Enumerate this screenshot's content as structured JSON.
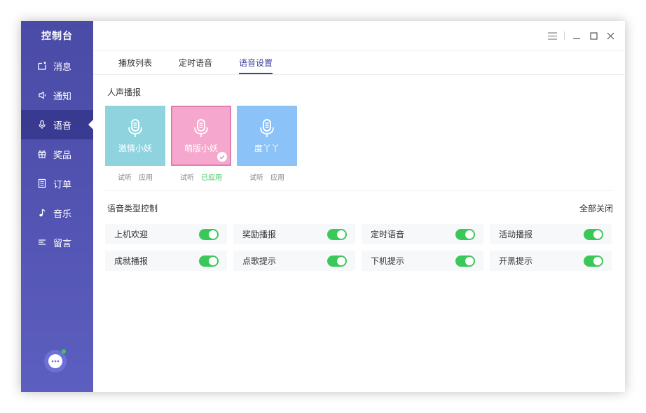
{
  "colors": {
    "accent": "#3f3fa6",
    "sidebar": "#5354b3",
    "switch_on": "#3bc85a",
    "applied": "#3cc55b"
  },
  "sidebar": {
    "brand": "控制台",
    "items": [
      {
        "label": "消息",
        "icon": "message-icon"
      },
      {
        "label": "通知",
        "icon": "speaker-icon"
      },
      {
        "label": "语音",
        "icon": "microphone-icon",
        "active": true
      },
      {
        "label": "奖品",
        "icon": "gift-icon"
      },
      {
        "label": "订单",
        "icon": "document-icon"
      },
      {
        "label": "音乐",
        "icon": "music-note-icon"
      },
      {
        "label": "留言",
        "icon": "lines-icon"
      }
    ],
    "chat_icon": "chat-bubble-icon"
  },
  "tabs": [
    {
      "label": "播放列表"
    },
    {
      "label": "定时语音"
    },
    {
      "label": "语音设置",
      "active": true
    }
  ],
  "voice_section": {
    "title": "人声播报",
    "voices": [
      {
        "name": "激情小妖",
        "color": "#8fd3df",
        "listen": "试听",
        "action": "应用",
        "selected": false
      },
      {
        "name": "萌版小妖",
        "color": "#f6a7cd",
        "listen": "试听",
        "action": "已应用",
        "selected": true
      },
      {
        "name": "度丫丫",
        "color": "#8bc2f8",
        "listen": "试听",
        "action": "应用",
        "selected": false
      }
    ]
  },
  "type_section": {
    "title": "语音类型控制",
    "close_all": "全部关闭",
    "toggles": [
      {
        "label": "上机欢迎",
        "on": true
      },
      {
        "label": "奖励播报",
        "on": true
      },
      {
        "label": "定时语音",
        "on": true
      },
      {
        "label": "活动播报",
        "on": true
      },
      {
        "label": "成就播报",
        "on": true
      },
      {
        "label": "点歌提示",
        "on": true
      },
      {
        "label": "下机提示",
        "on": true
      },
      {
        "label": "开黑提示",
        "on": true
      }
    ]
  }
}
